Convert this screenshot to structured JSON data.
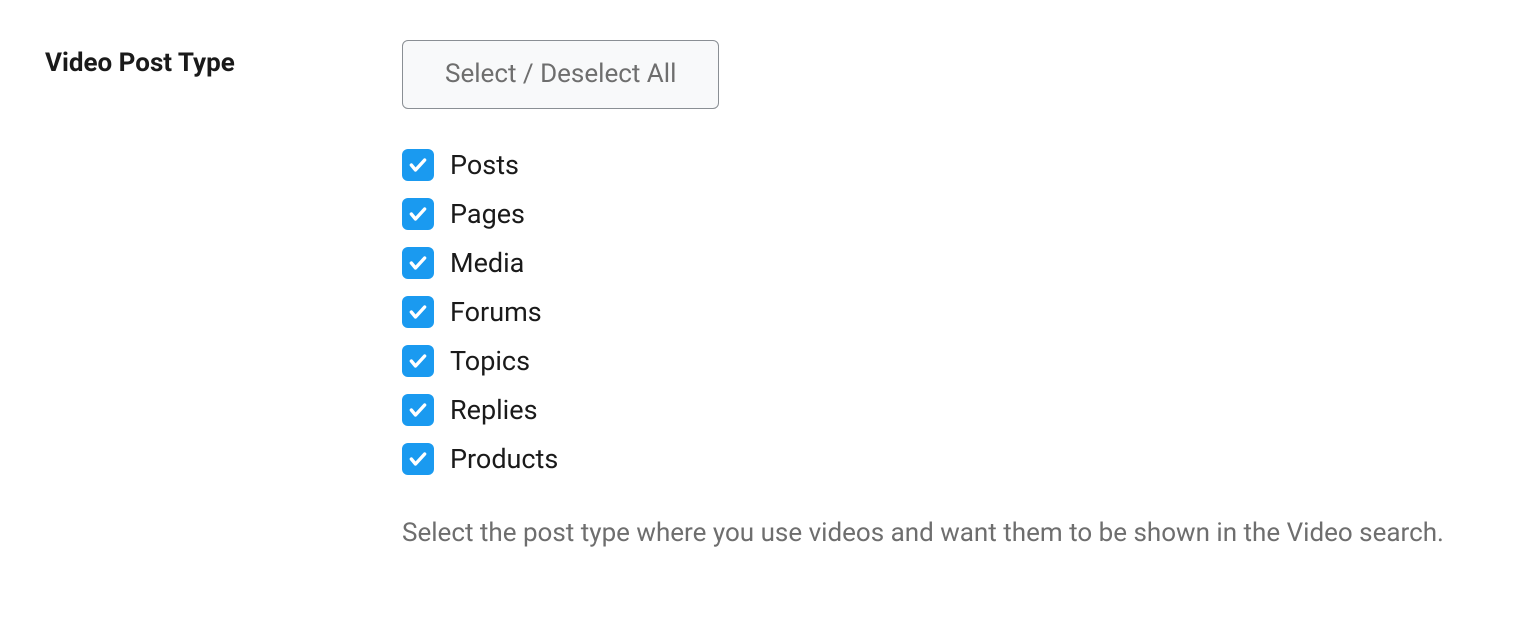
{
  "section": {
    "label": "Video Post Type",
    "select_all_label": "Select / Deselect All",
    "description": "Select the post type where you use videos and want them to be shown in the Video search.",
    "options": [
      {
        "label": "Posts",
        "checked": true
      },
      {
        "label": "Pages",
        "checked": true
      },
      {
        "label": "Media",
        "checked": true
      },
      {
        "label": "Forums",
        "checked": true
      },
      {
        "label": "Topics",
        "checked": true
      },
      {
        "label": "Replies",
        "checked": true
      },
      {
        "label": "Products",
        "checked": true
      }
    ]
  }
}
